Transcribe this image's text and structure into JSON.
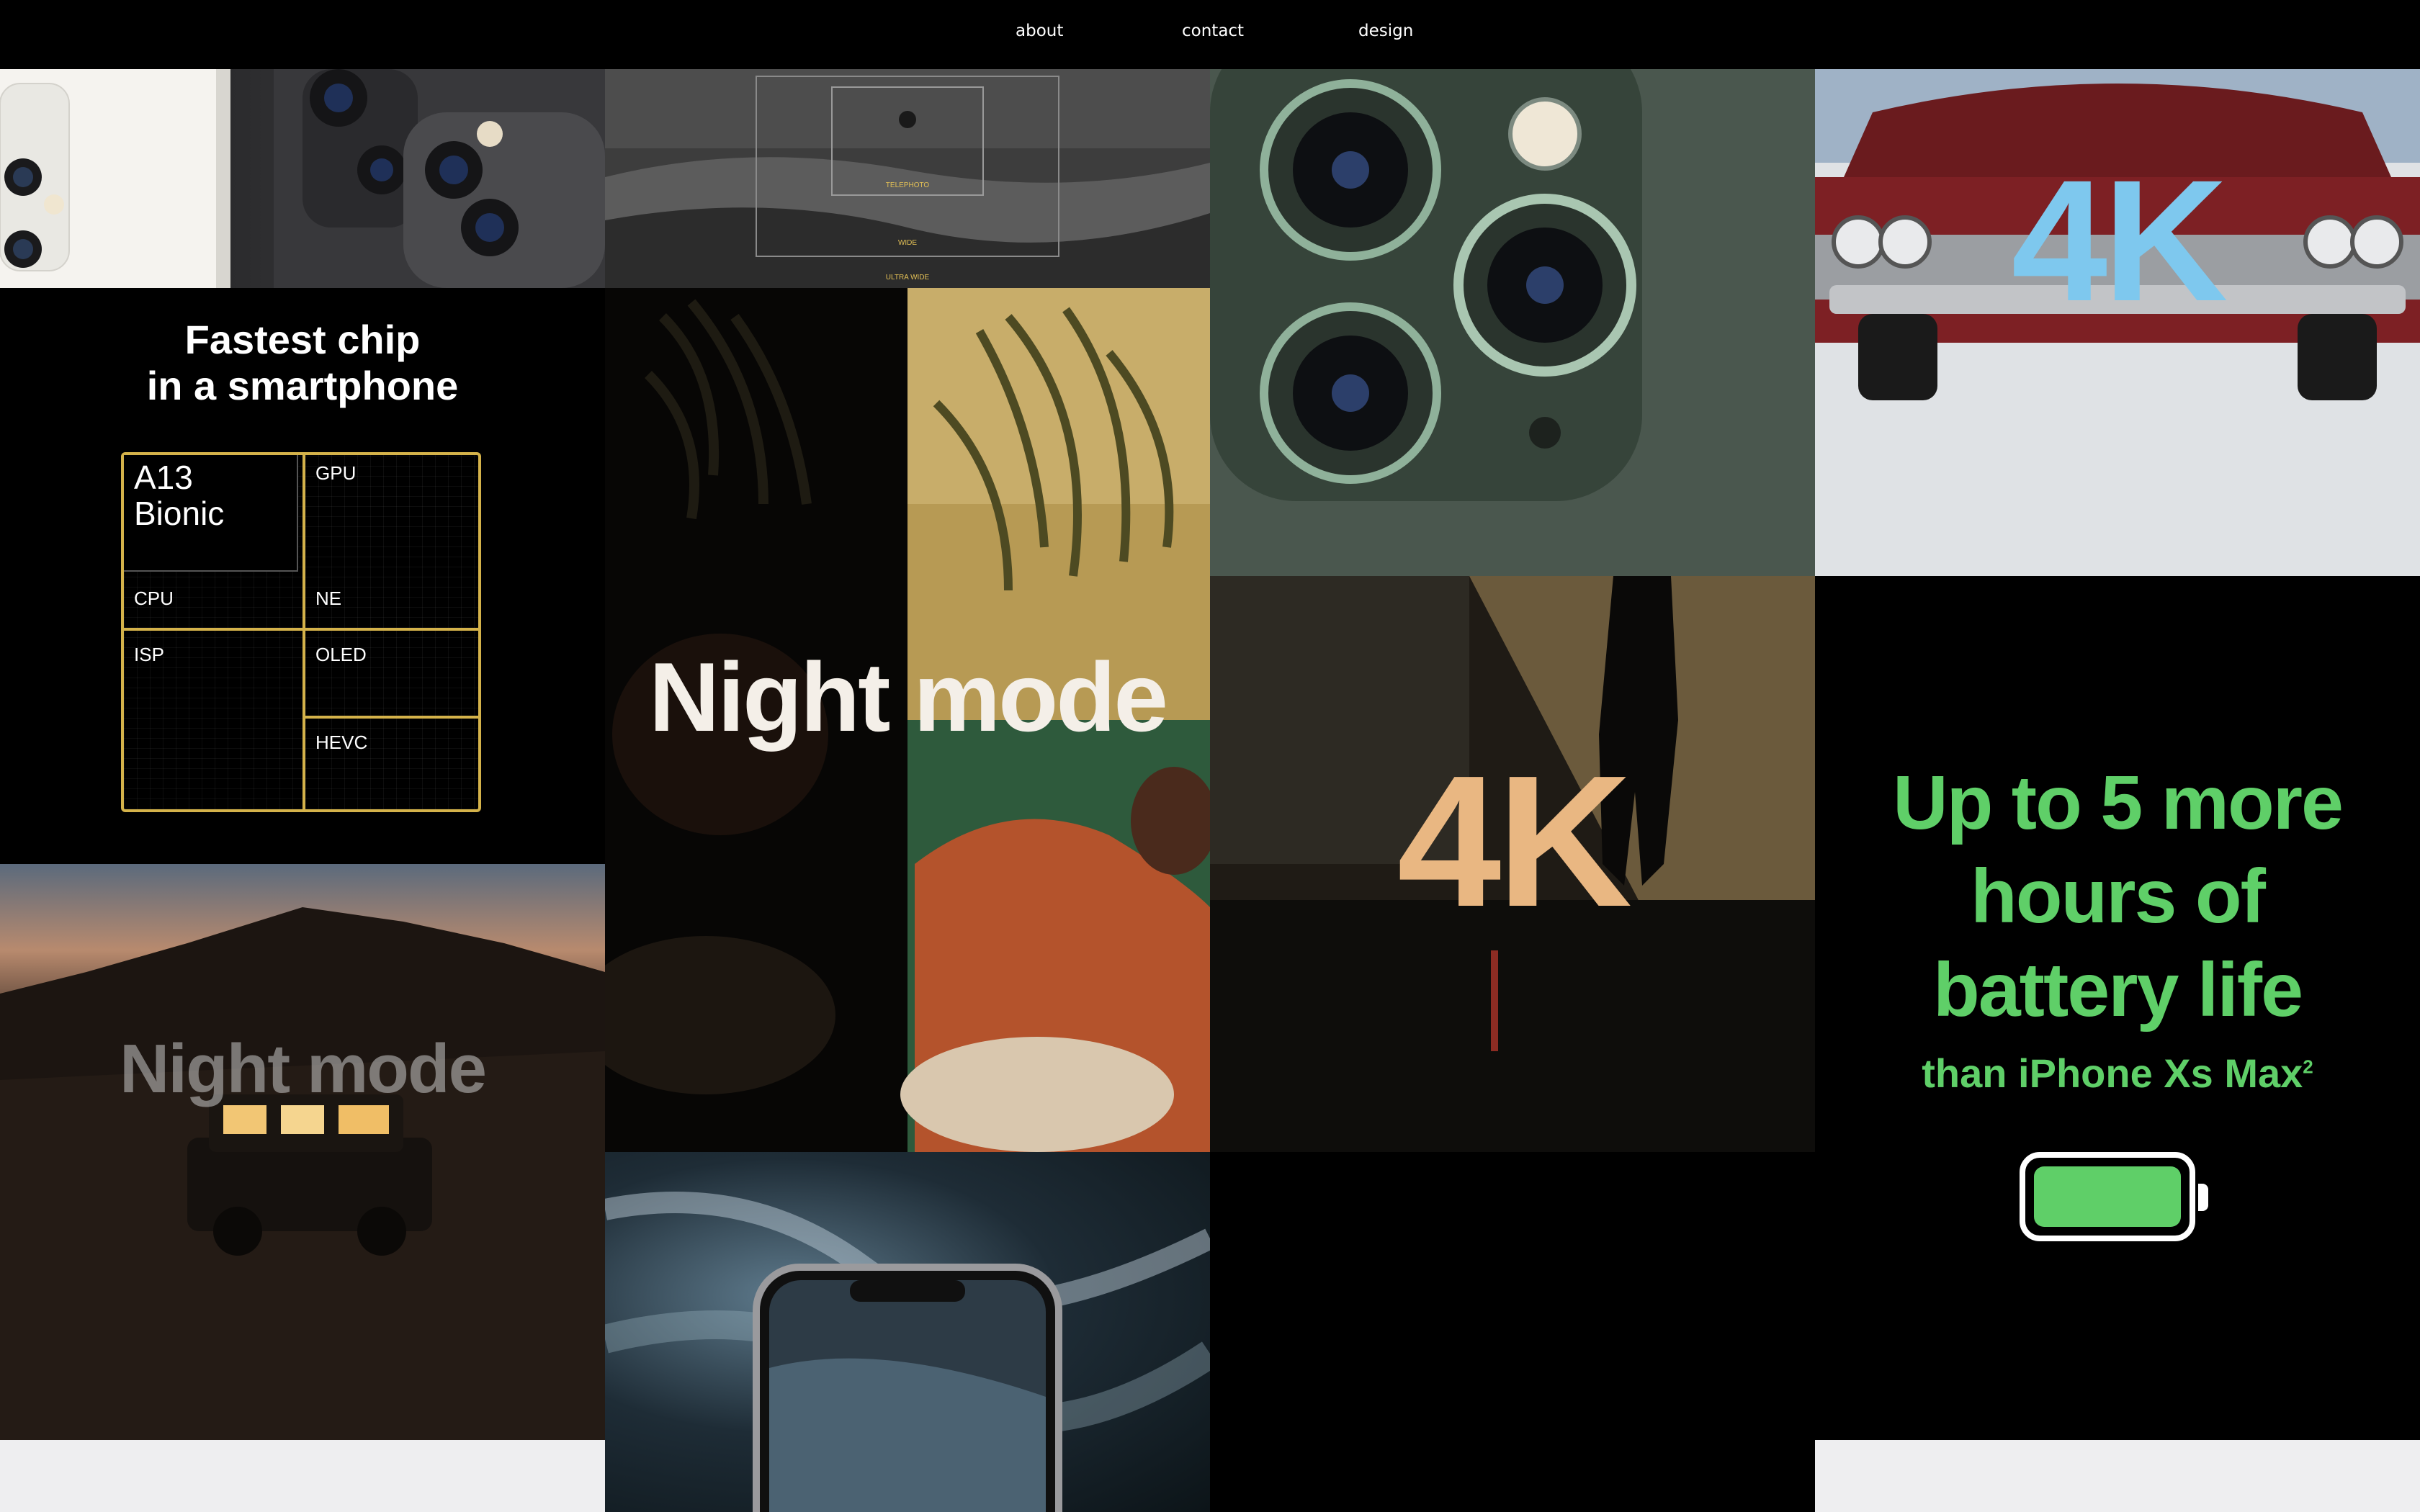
{
  "nav": {
    "items": [
      "about",
      "contact",
      "design"
    ]
  },
  "chip": {
    "title_line1": "Fastest chip",
    "title_line2": "in a smartphone",
    "block_name_1": "A13",
    "block_name_2": "Bionic",
    "gpu": "GPU",
    "cpu": "CPU",
    "ne": "NE",
    "isp": "ISP",
    "oled": "OLED",
    "hevc": "HEVC"
  },
  "landscape": {
    "telephoto": "TELEPHOTO",
    "wide": "WIDE",
    "ultra_wide": "ULTRA WIDE"
  },
  "night_mode": {
    "main": "Night mode",
    "car": "Night mode"
  },
  "k4": {
    "car": "4K",
    "dark": "4K"
  },
  "battery": {
    "line1": "Up to 5 more",
    "line2": "hours of",
    "line3": "battery life",
    "line4": "than iPhone Xs Max",
    "footnote": "2"
  },
  "colors": {
    "battery_green": "#5fcf68",
    "chip_gold": "#d4b24a",
    "night_mode_text": "#f4efe8"
  }
}
